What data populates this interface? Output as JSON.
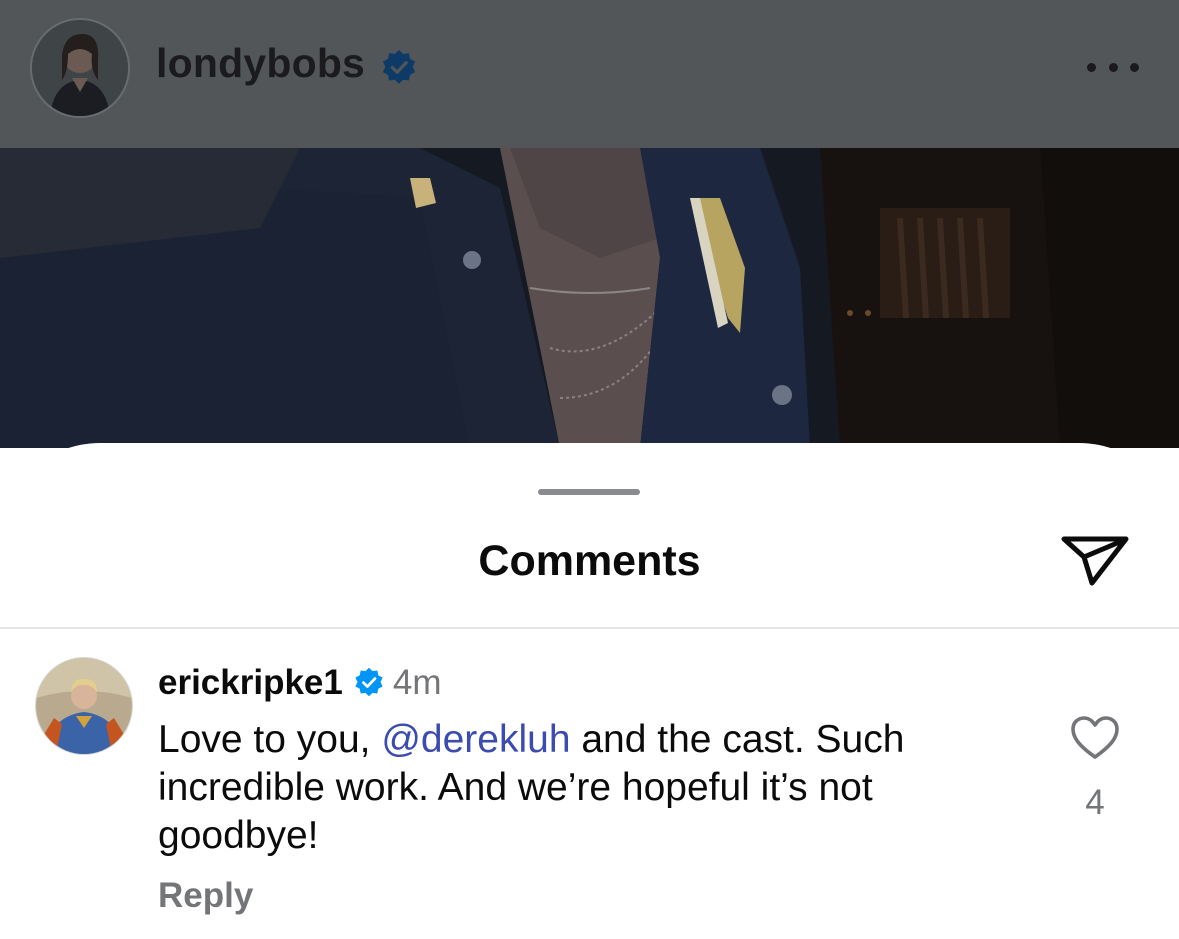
{
  "post": {
    "username": "londybobs",
    "verified": true
  },
  "comments_sheet": {
    "title": "Comments"
  },
  "comment": {
    "username": "erickripke1",
    "verified": true,
    "time": "4m",
    "text_before_mention": "Love to you, ",
    "mention": "@derekluh",
    "text_after_mention": " and the cast. Such incredible work. And we’re hopeful it’s not goodbye!",
    "reply_label": "Reply",
    "like_count": "4"
  },
  "icons": {
    "more": "more-horizontal-icon",
    "verified": "verified-badge-icon",
    "share": "paper-plane-icon",
    "like": "heart-icon"
  },
  "colors": {
    "verified_blue": "#0095f6",
    "mention": "#3b4bb0",
    "secondary_text": "#737578",
    "overlay": "#525659"
  }
}
